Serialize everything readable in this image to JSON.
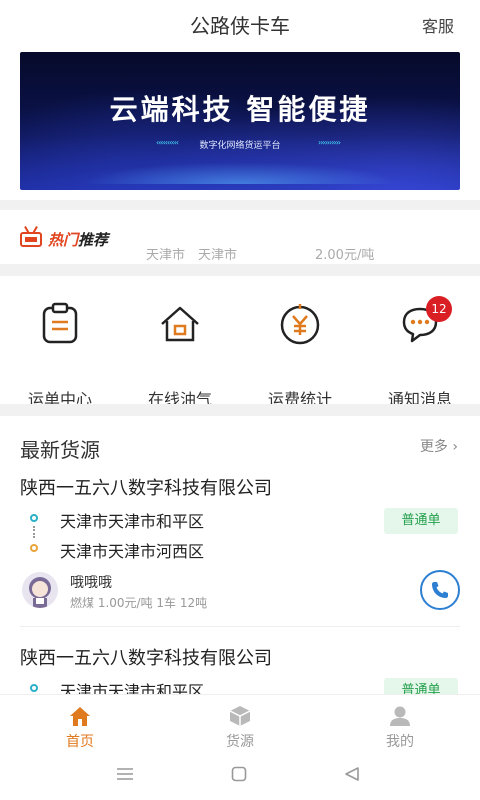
{
  "header": {
    "title": "公路侠卡车",
    "service_label": "客服"
  },
  "banner": {
    "headline": "云端科技  智能便捷",
    "subtitle": "数字化网络货运平台"
  },
  "hot": {
    "label_part1": "热门",
    "label_part2": "推荐",
    "ticker": "天津市　天津市　　　　　　2.00元/吨"
  },
  "menu": {
    "items": [
      {
        "label": "运单中心",
        "icon": "waybill-icon"
      },
      {
        "label": "在线油气",
        "icon": "gas-station-icon"
      },
      {
        "label": "运费统计",
        "icon": "yuan-coin-icon"
      },
      {
        "label": "通知消息",
        "icon": "message-bubble-icon",
        "badge": "12"
      }
    ]
  },
  "latest": {
    "title": "最新货源",
    "more_label": "更多",
    "cards": [
      {
        "company": "陕西一五六八数字科技有限公司",
        "from": "天津市天津市和平区",
        "to": "天津市天津市河西区",
        "tag": "普通单",
        "user": "哦哦哦",
        "cargo": "燃煤 1.00元/吨 1车 12吨"
      },
      {
        "company": "陕西一五六八数字科技有限公司",
        "from": "天津市天津市和平区",
        "tag": "普通单"
      }
    ]
  },
  "tabbar": {
    "items": [
      {
        "label": "首页",
        "active": true
      },
      {
        "label": "货源",
        "active": false
      },
      {
        "label": "我的",
        "active": false
      }
    ],
    "active_color": "#e07a1f",
    "inactive_color": "#999999"
  },
  "colors": {
    "accent": "#e07a1f",
    "tag_green": "#23a04c",
    "badge_red": "#d91e24",
    "phone_blue": "#2d7fd2"
  }
}
